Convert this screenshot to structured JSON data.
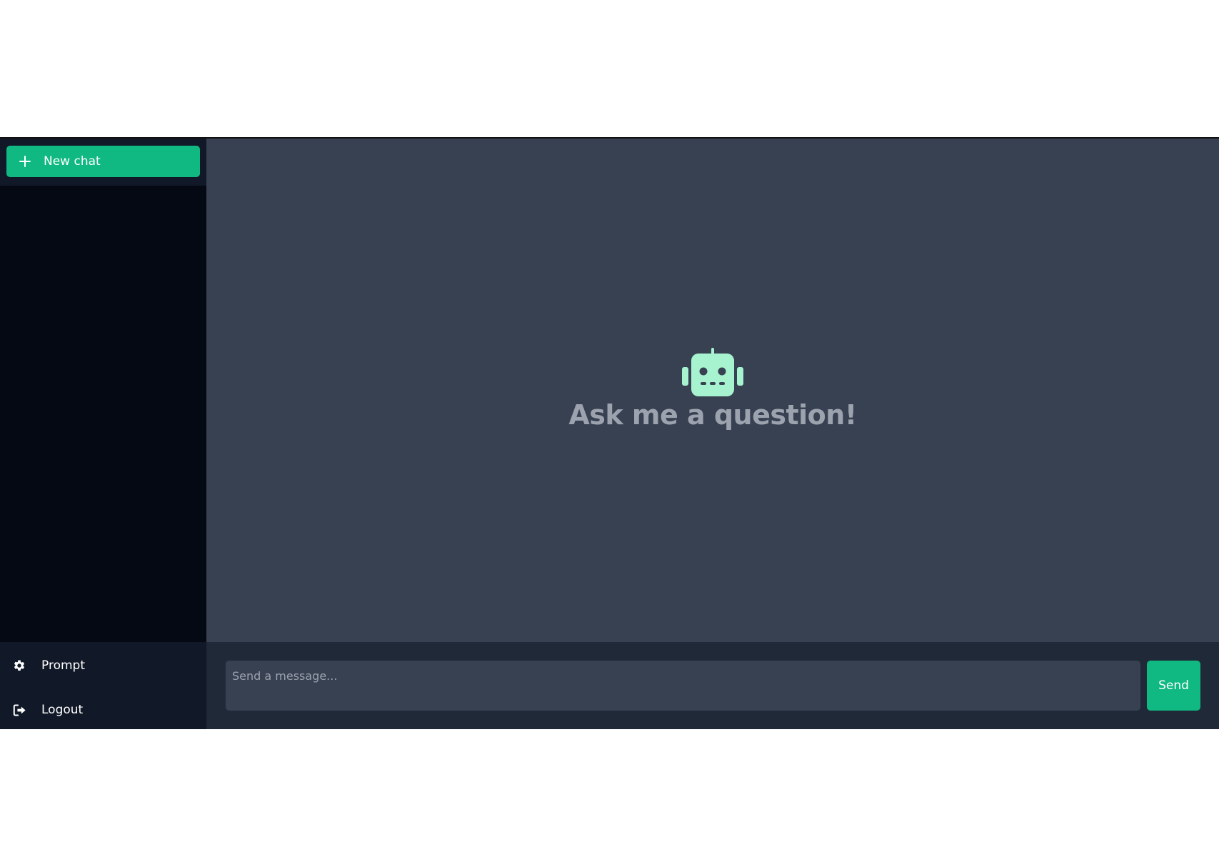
{
  "sidebar": {
    "new_chat": {
      "label": "New chat",
      "icon": "plus-icon"
    },
    "links": [
      {
        "label": "Prompt",
        "icon": "gear-icon"
      },
      {
        "label": "Logout",
        "icon": "logout-icon"
      }
    ]
  },
  "main": {
    "empty_state": {
      "icon": "robot-icon",
      "title": "Ask me a question!"
    },
    "composer": {
      "placeholder": "Send a message...",
      "value": "",
      "send_label": "Send"
    }
  },
  "colors": {
    "accent": "#10b981",
    "robot": "#a7f3d0",
    "sidebar_bg": "#050914",
    "sidebar_panel_bg": "#111827",
    "main_bg": "#374151",
    "composer_bg": "#1f2937",
    "muted_text": "#9ca3af"
  }
}
